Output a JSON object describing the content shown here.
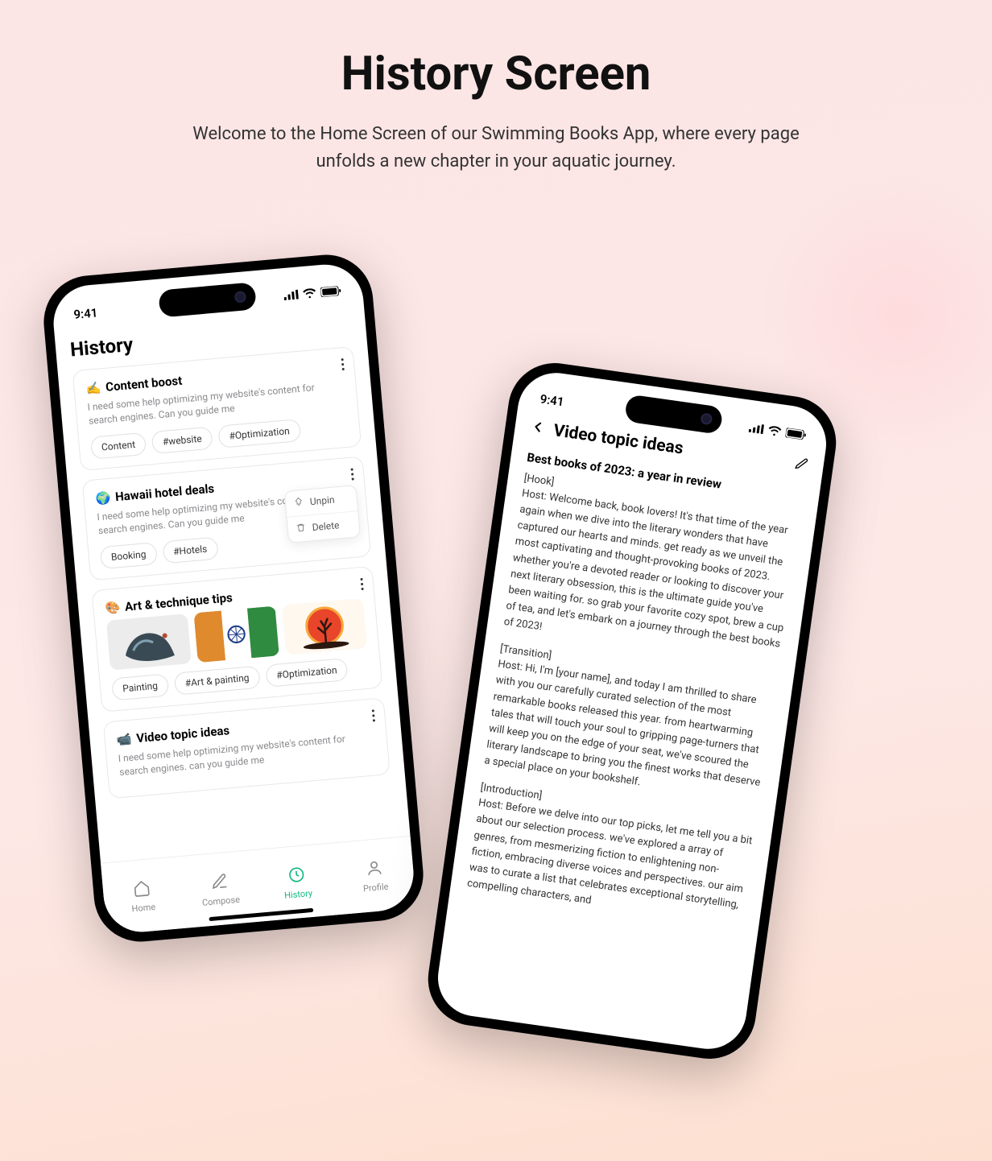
{
  "page": {
    "title": "History Screen",
    "subtitle": "Welcome to the Home Screen of our Swimming Books App, where every page unfolds a new chapter in your aquatic journey."
  },
  "status": {
    "time": "9:41"
  },
  "history": {
    "heading": "History",
    "popover": {
      "unpin": "Unpin",
      "delete": "Delete"
    },
    "cards": [
      {
        "emoji": "✍️",
        "title": "Content boost",
        "desc": "I need some help optimizing my website's content for search engines. Can you guide me",
        "chips": [
          "Content",
          "#website",
          "#Optimization"
        ]
      },
      {
        "emoji": "🌍",
        "title": "Hawaii hotel deals",
        "desc": "I need some help optimizing my website's content for search engines. Can you guide me",
        "chips": [
          "Booking",
          "#Hotels"
        ]
      },
      {
        "emoji": "🎨",
        "title": "Art & technique tips",
        "desc": "",
        "chips": [
          "Painting",
          "#Art & painting",
          "#Optimization"
        ]
      },
      {
        "emoji": "📹",
        "title": "Video topic ideas",
        "desc": "I need some help optimizing my website's content for search engines. can you guide me",
        "chips": []
      }
    ]
  },
  "nav": {
    "home": "Home",
    "compose": "Compose",
    "history": "History",
    "profile": "Profile"
  },
  "detail": {
    "title": "Video topic ideas",
    "h2": "Best books of 2023: a year in review",
    "sections": [
      {
        "label": "[Hook]",
        "text": "Host: Welcome back, book lovers! It's that time of the year again when we dive into the literary wonders that have captured our hearts and minds. get ready as we unveil the most captivating and thought-provoking books of 2023. whether you're a devoted reader or looking to discover your next literary obsession, this is the ultimate guide you've been waiting for. so grab your favorite cozy spot, brew a cup of tea, and let's embark on a journey through the best books of 2023!"
      },
      {
        "label": "[Transition]",
        "text": "Host: Hi, I'm [your name], and today I am thrilled to share with you our carefully curated selection of the most remarkable books released this year. from heartwarming tales that will touch your soul to gripping page-turners that will keep you on the edge of your seat, we've scoured the literary landscape to bring you the finest works that deserve a special place on your bookshelf."
      },
      {
        "label": "[Introduction]",
        "text": "Host: Before we delve into our top picks, let me tell you a bit about our selection process. we've explored a array of genres, from mesmerizing fiction to enlightening non-fiction, embracing diverse voices and perspectives. our aim was to curate a list that celebrates exceptional storytelling, compelling characters, and"
      }
    ]
  }
}
